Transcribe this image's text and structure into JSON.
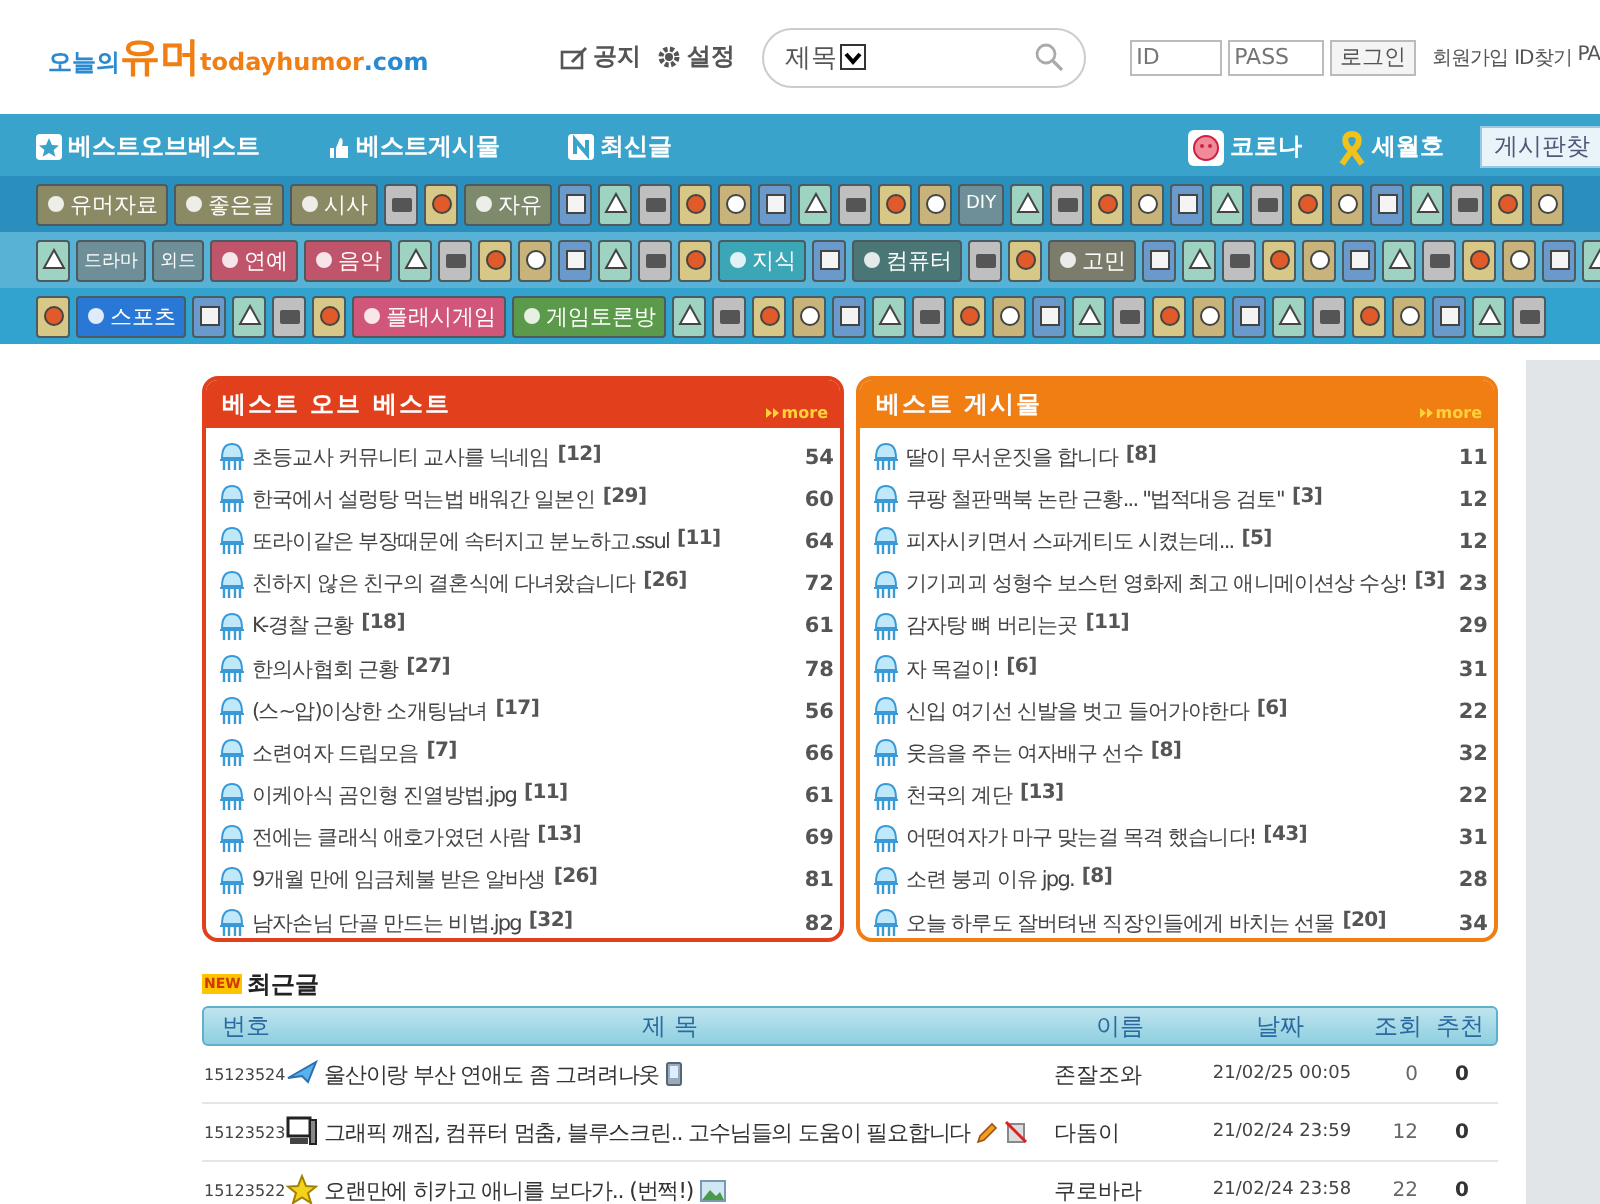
{
  "header": {
    "logo": {
      "prefix": "오늘의",
      "name": "유머",
      "domain": "todayhumor",
      "tld": ".com"
    },
    "links": [
      {
        "kind": "notice",
        "label": "공지"
      },
      {
        "kind": "settings",
        "label": "설정"
      }
    ],
    "search": {
      "scope": "제목"
    },
    "login": {
      "id_placeholder": "ID",
      "pass_placeholder": "PASS",
      "button": "로그인",
      "links": [
        "회원가입",
        "ID찾기",
        "PA"
      ]
    }
  },
  "nav": {
    "left": [
      {
        "kind": "star",
        "label": "베스트오브베스트"
      },
      {
        "kind": "thumb",
        "label": "베스트게시물"
      },
      {
        "kind": "new",
        "label": "최신글"
      }
    ],
    "right": [
      {
        "kind": "corona",
        "label": "코로나"
      },
      {
        "kind": "ribbon",
        "label": "세월호"
      }
    ],
    "button": "게시판찾"
  },
  "boards": [
    {
      "items": [
        {
          "kind": "label",
          "label": "유머자료",
          "color": "#8b8a64"
        },
        {
          "kind": "label",
          "label": "좋은글",
          "color": "#8b8a64"
        },
        {
          "kind": "label",
          "label": "시사",
          "color": "#8b8a64"
        },
        {
          "kind": "icon"
        },
        {
          "kind": "icon"
        },
        {
          "kind": "label",
          "label": "자유",
          "color": "#7d8a6c"
        },
        {
          "kind": "icon"
        },
        {
          "kind": "icon"
        },
        {
          "kind": "icon"
        },
        {
          "kind": "icon"
        },
        {
          "kind": "icon"
        },
        {
          "kind": "icon"
        },
        {
          "kind": "icon"
        },
        {
          "kind": "icon"
        },
        {
          "kind": "icon"
        },
        {
          "kind": "icon"
        },
        {
          "kind": "text",
          "label": "DIY"
        },
        {
          "kind": "icon"
        },
        {
          "kind": "icon"
        },
        {
          "kind": "icon"
        },
        {
          "kind": "icon"
        },
        {
          "kind": "icon"
        },
        {
          "kind": "icon"
        },
        {
          "kind": "icon"
        },
        {
          "kind": "icon"
        },
        {
          "kind": "icon"
        },
        {
          "kind": "icon"
        },
        {
          "kind": "icon"
        },
        {
          "kind": "icon"
        },
        {
          "kind": "icon"
        },
        {
          "kind": "icon"
        }
      ]
    },
    {
      "items": [
        {
          "kind": "icon"
        },
        {
          "kind": "text",
          "label": "드라마"
        },
        {
          "kind": "text",
          "label": "외드"
        },
        {
          "kind": "label",
          "label": "연예",
          "color": "#c0546a"
        },
        {
          "kind": "label",
          "label": "음악",
          "color": "#c0546a"
        },
        {
          "kind": "icon"
        },
        {
          "kind": "icon"
        },
        {
          "kind": "icon"
        },
        {
          "kind": "icon"
        },
        {
          "kind": "icon"
        },
        {
          "kind": "icon"
        },
        {
          "kind": "icon"
        },
        {
          "kind": "icon"
        },
        {
          "kind": "label",
          "label": "지식",
          "color": "#3aa6b6"
        },
        {
          "kind": "icon"
        },
        {
          "kind": "label",
          "label": "컴퓨터",
          "color": "#4a7676"
        },
        {
          "kind": "icon"
        },
        {
          "kind": "icon"
        },
        {
          "kind": "label",
          "label": "고민",
          "color": "#7c7c6c"
        },
        {
          "kind": "icon"
        },
        {
          "kind": "icon"
        },
        {
          "kind": "icon"
        },
        {
          "kind": "icon"
        },
        {
          "kind": "icon"
        },
        {
          "kind": "icon"
        },
        {
          "kind": "icon"
        },
        {
          "kind": "icon"
        },
        {
          "kind": "icon"
        },
        {
          "kind": "icon"
        },
        {
          "kind": "icon"
        },
        {
          "kind": "icon"
        }
      ]
    },
    {
      "items": [
        {
          "kind": "icon"
        },
        {
          "kind": "label",
          "label": "스포츠",
          "color": "#2a78d6"
        },
        {
          "kind": "icon"
        },
        {
          "kind": "icon"
        },
        {
          "kind": "icon"
        },
        {
          "kind": "icon"
        },
        {
          "kind": "label",
          "label": "플래시게임",
          "color": "#d0567a"
        },
        {
          "kind": "label",
          "label": "게임토론방",
          "color": "#5a9a4a"
        },
        {
          "kind": "icon"
        },
        {
          "kind": "icon"
        },
        {
          "kind": "icon"
        },
        {
          "kind": "icon"
        },
        {
          "kind": "icon"
        },
        {
          "kind": "icon"
        },
        {
          "kind": "icon"
        },
        {
          "kind": "icon"
        },
        {
          "kind": "icon"
        },
        {
          "kind": "icon"
        },
        {
          "kind": "icon"
        },
        {
          "kind": "icon"
        },
        {
          "kind": "icon"
        },
        {
          "kind": "icon"
        },
        {
          "kind": "icon"
        },
        {
          "kind": "icon"
        },
        {
          "kind": "icon"
        },
        {
          "kind": "icon"
        },
        {
          "kind": "icon"
        },
        {
          "kind": "icon"
        },
        {
          "kind": "icon"
        },
        {
          "kind": "icon"
        }
      ]
    }
  ],
  "best_panels": [
    {
      "title": "베스트 오브 베스트",
      "more": "more",
      "color": "#e2401c",
      "items": [
        {
          "title": "초등교사 커뮤니티 교사를 닉네임",
          "comments": "[12]",
          "score": "54"
        },
        {
          "title": "한국에서 설렁탕 먹는법 배워간 일본인",
          "comments": "[29]",
          "score": "60"
        },
        {
          "title": "또라이같은 부장때문에 속터지고 분노하고.ssul",
          "comments": "[11]",
          "score": "64"
        },
        {
          "title": "친하지 않은 친구의 결혼식에 다녀왔습니다",
          "comments": "[26]",
          "score": "72"
        },
        {
          "title": "K-경찰 근황",
          "comments": "[18]",
          "score": "61"
        },
        {
          "title": "한의사협회 근황",
          "comments": "[27]",
          "score": "78"
        },
        {
          "title": "(스~압)이상한 소개팅남녀",
          "comments": "[17]",
          "score": "56"
        },
        {
          "title": "소련여자 드립모음",
          "comments": "[7]",
          "score": "66"
        },
        {
          "title": "이케아식 곰인형 진열방법.jpg",
          "comments": "[11]",
          "score": "61"
        },
        {
          "title": "전에는 클래식 애호가였던 사람",
          "comments": "[13]",
          "score": "69"
        },
        {
          "title": "9개월 만에 임금체불 받은 알바생",
          "comments": "[26]",
          "score": "81"
        },
        {
          "title": "남자손님 단골 만드는 비법.jpg",
          "comments": "[32]",
          "score": "82"
        }
      ]
    },
    {
      "title": "베스트 게시물",
      "more": "more",
      "color": "#f07e12",
      "items": [
        {
          "title": "딸이 무서운짓을 합니다",
          "comments": "[8]",
          "score": "11"
        },
        {
          "title": "쿠팡 철판맥북 논란 근황... \"법적대응 검토\"",
          "comments": "[3]",
          "score": "12"
        },
        {
          "title": "피자시키면서 스파게티도 시켰는데...",
          "comments": "[5]",
          "score": "12"
        },
        {
          "title": "기기괴괴 성형수 보스턴 영화제 최고 애니메이션상 수상!",
          "comments": "[3]",
          "score": "23"
        },
        {
          "title": "감자탕 뼈 버리는곳",
          "comments": "[11]",
          "score": "29"
        },
        {
          "title": "자 목걸이!",
          "comments": "[6]",
          "score": "31"
        },
        {
          "title": "신입 여기선 신발을 벗고 들어가야한다",
          "comments": "[6]",
          "score": "22"
        },
        {
          "title": "웃음을 주는 여자배구 선수",
          "comments": "[8]",
          "score": "32"
        },
        {
          "title": "천국의 계단",
          "comments": "[13]",
          "score": "22"
        },
        {
          "title": "어떤여자가 마구 맞는걸 목격 했습니다!",
          "comments": "[43]",
          "score": "31"
        },
        {
          "title": "소련 붕괴 이유 jpg.",
          "comments": "[8]",
          "score": "28"
        },
        {
          "title": "오늘 하루도 잘버텨낸 직장인들에게 바치는 선물",
          "comments": "[20]",
          "score": "34"
        }
      ]
    }
  ],
  "recent": {
    "badge": "NEW",
    "title": "최근글",
    "columns": [
      "번호",
      "제 목",
      "이름",
      "날짜",
      "조회",
      "추천"
    ],
    "rows": [
      {
        "number": "15123524",
        "kind": "plane",
        "title": "울산이랑 부산 연애도 좀 그려려나옷",
        "mobile": true,
        "author": "존잘조와",
        "date": "21/02/25 00:05",
        "views": "0",
        "recommend": "0"
      },
      {
        "number": "15123523",
        "kind": "computer",
        "title": "그래픽 깨짐, 컴퓨터 멈춤, 블루스크린.. 고수님들의 도움이 필요합니다",
        "edited": true,
        "no_image": true,
        "author": "다돔이",
        "date": "21/02/24 23:59",
        "views": "12",
        "recommend": "0"
      },
      {
        "number": "15123522",
        "kind": "star",
        "title": "오랜만에 히카고 애니를 보다가.. (번쩍!)",
        "image": true,
        "author": "쿠로바라",
        "date": "21/02/24 23:58",
        "views": "22",
        "recommend": "0"
      }
    ]
  }
}
